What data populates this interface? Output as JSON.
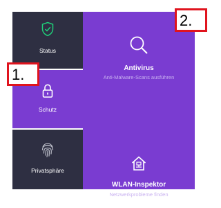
{
  "sidebar": {
    "items": [
      {
        "id": "status",
        "label": "Status",
        "icon": "shield-check-icon"
      },
      {
        "id": "schutz",
        "label": "Schutz",
        "icon": "lock-icon",
        "active": true
      },
      {
        "id": "privat",
        "label": "Privatsphäre",
        "icon": "fingerprint-icon"
      }
    ]
  },
  "main": {
    "features": [
      {
        "title": "Antivirus",
        "subtitle": "Anti-Malware-Scans ausführen",
        "icon": "magnifier-icon"
      },
      {
        "title": "WLAN-Inspektor",
        "subtitle": "Netzwerkprobleme finden",
        "icon": "home-network-icon"
      }
    ]
  },
  "annotations": {
    "callout_1": "1.",
    "callout_2": "2."
  },
  "colors": {
    "sidebar_bg": "#2e2f42",
    "accent_purple": "#7a3cd1",
    "status_green": "#1fd17a",
    "callout_border": "#e0141e"
  }
}
